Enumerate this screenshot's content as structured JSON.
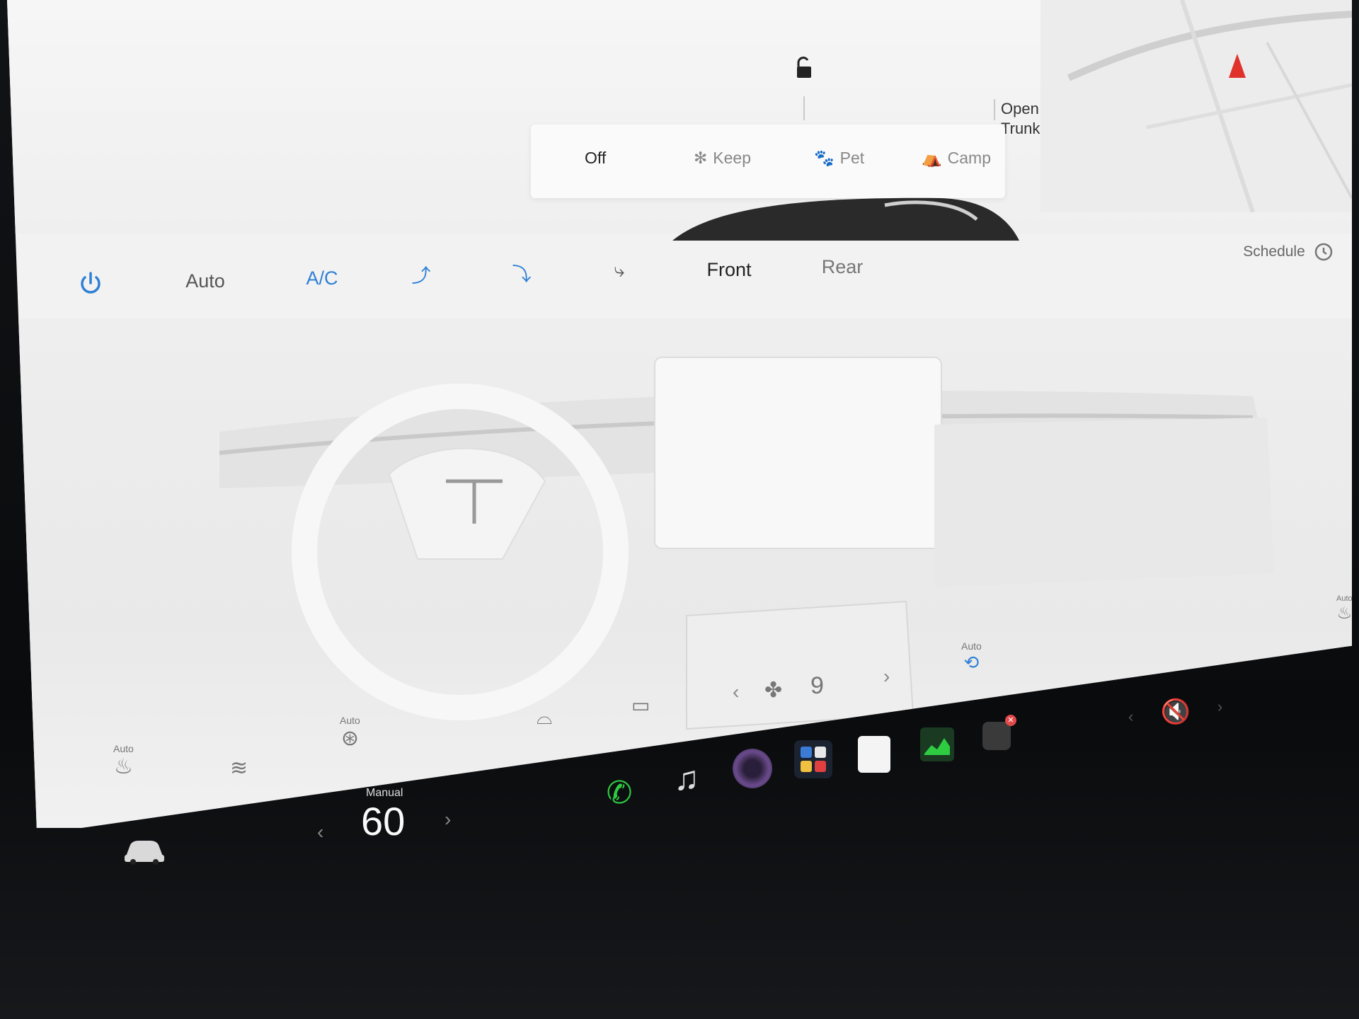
{
  "top": {
    "trunk_label": "Open\nTrunk",
    "modes": [
      {
        "label": "Off",
        "active": true
      },
      {
        "label": "Keep",
        "active": false
      },
      {
        "label": "Pet",
        "active": false
      },
      {
        "label": "Camp",
        "active": false
      }
    ]
  },
  "climate": {
    "power_icon": "power-icon",
    "auto_label": "Auto",
    "ac_label": "A/C",
    "front_label": "Front",
    "rear_label": "Rear",
    "schedule_label": "Schedule",
    "fan_speed": "9",
    "recirc_auto": "Auto",
    "seat_left_auto": "Auto",
    "wheel_heat_auto": "Auto",
    "seat_right_auto": "Auto"
  },
  "dock": {
    "temp_mode": "Manual",
    "temperature": "60"
  },
  "colors": {
    "accent_blue": "#2f80d6",
    "phone_green": "#2ecc40",
    "nav_red": "#e0322b"
  }
}
